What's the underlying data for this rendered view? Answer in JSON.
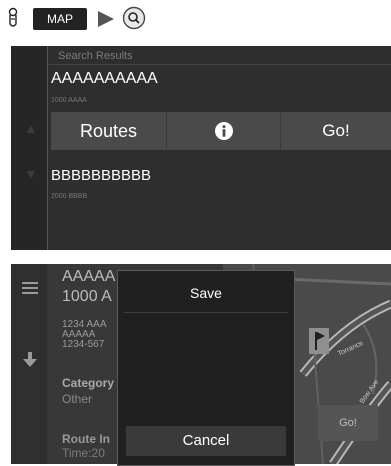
{
  "breadcrumb": {
    "voice_icon": "voice-command-icon",
    "map_button_label": "MAP",
    "arrow_icon": "right-arrow-icon",
    "search_icon": "search-icon"
  },
  "panel1": {
    "section_label": "Search Results",
    "results": [
      {
        "name": "AAAAAAAAAA",
        "distance": "1000 AAAA"
      },
      {
        "name": "BBBBBBBBBB",
        "distance": "2000 BBBB"
      }
    ],
    "actions": {
      "routes_label": "Routes",
      "info_icon": "info-icon",
      "go_label": "Go!"
    }
  },
  "panel2": {
    "place_name_line1": "AAAAA",
    "place_name_line2": "1000 A",
    "address_lines": [
      "1234 AAA",
      "AAAAA",
      "1234-567"
    ],
    "category_heading": "Category",
    "category_value": "Other",
    "route_info_heading": "Route In",
    "route_info_value": "Time:20",
    "go_label": "Go!",
    "street_labels": [
      "Torrance",
      "Bow Ave"
    ]
  },
  "dialog": {
    "title": "Save",
    "cancel_label": "Cancel"
  },
  "colors": {
    "panel_bg": "#2e2e2e",
    "actionbar_bg": "#4a4a4a",
    "dialog_bg": "#202020",
    "text": "#ffffff"
  }
}
